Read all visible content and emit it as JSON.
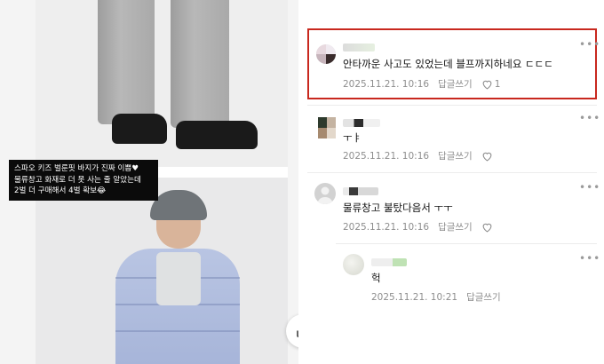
{
  "caption": {
    "lines": [
      "스파오 키즈 벌룬핏 바지가 진짜 이쁨♥",
      "물류창고 화재로 더 못 사는 줄 알았는데",
      "2벌 더 구매해서 4벌 확보😂"
    ]
  },
  "comments": [
    {
      "text": "안타까운 사고도 있었는데 블프까지하네요 ㄷㄷㄷ",
      "timestamp": "2025.11.21. 10:16",
      "reply_label": "답글쓰기",
      "like_count": "1",
      "highlighted": true
    },
    {
      "text": "ㅜㅑ",
      "timestamp": "2025.11.21. 10:16",
      "reply_label": "답글쓰기",
      "like_count": ""
    },
    {
      "text": "물류창고 불탔다음서 ㅜㅜ",
      "timestamp": "2025.11.21. 10:16",
      "reply_label": "답글쓰기",
      "like_count": ""
    },
    {
      "text": "헉",
      "timestamp": "2025.11.21. 10:21",
      "reply_label": "답글쓰기",
      "is_reply": true
    }
  ],
  "icons": {
    "more": "more-options-icon",
    "heart": "heart-icon",
    "share": "share-icon"
  },
  "colors": {
    "highlight_border": "#c8281e",
    "meta_text": "#8e8e8e"
  }
}
